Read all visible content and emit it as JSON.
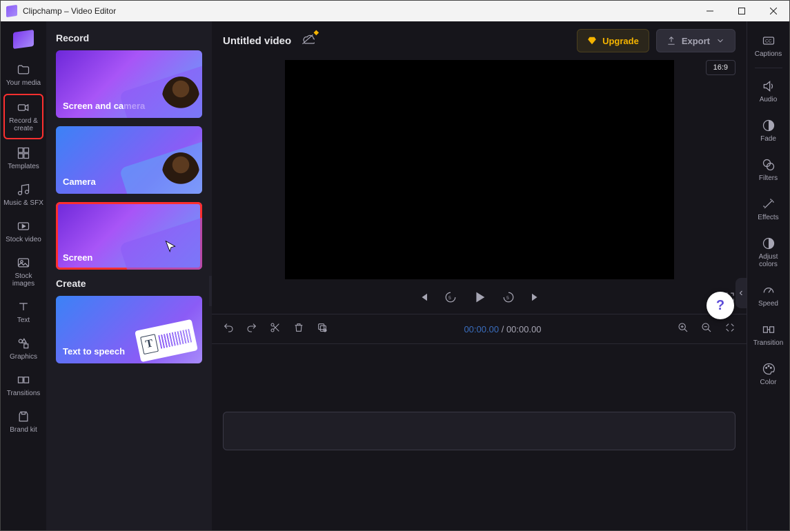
{
  "window": {
    "title": "Clipchamp – Video Editor"
  },
  "nav": {
    "items": [
      {
        "label": "Your media"
      },
      {
        "label": "Record & create"
      },
      {
        "label": "Templates"
      },
      {
        "label": "Music & SFX"
      },
      {
        "label": "Stock video"
      },
      {
        "label": "Stock images"
      },
      {
        "label": "Text"
      },
      {
        "label": "Graphics"
      },
      {
        "label": "Transitions"
      },
      {
        "label": "Brand kit"
      }
    ]
  },
  "panel": {
    "section_record": "Record",
    "section_create": "Create",
    "cards": {
      "screen_camera": "Screen and camera",
      "camera": "Camera",
      "screen": "Screen",
      "tts": "Text to speech"
    }
  },
  "topbar": {
    "project_title": "Untitled video",
    "upgrade": "Upgrade",
    "export": "Export",
    "aspect": "16:9"
  },
  "timeline": {
    "current": "00:00.00",
    "separator": "/",
    "total": "00:00.00"
  },
  "rail": {
    "items": [
      {
        "label": "Captions"
      },
      {
        "label": "Audio"
      },
      {
        "label": "Fade"
      },
      {
        "label": "Filters"
      },
      {
        "label": "Effects"
      },
      {
        "label": "Adjust colors"
      },
      {
        "label": "Speed"
      },
      {
        "label": "Transition"
      },
      {
        "label": "Color"
      }
    ]
  },
  "help": {
    "glyph": "?"
  },
  "colors": {
    "accent": "#8b5cf6",
    "gold": "#f5b400",
    "highlight": "#ff2f2f"
  }
}
